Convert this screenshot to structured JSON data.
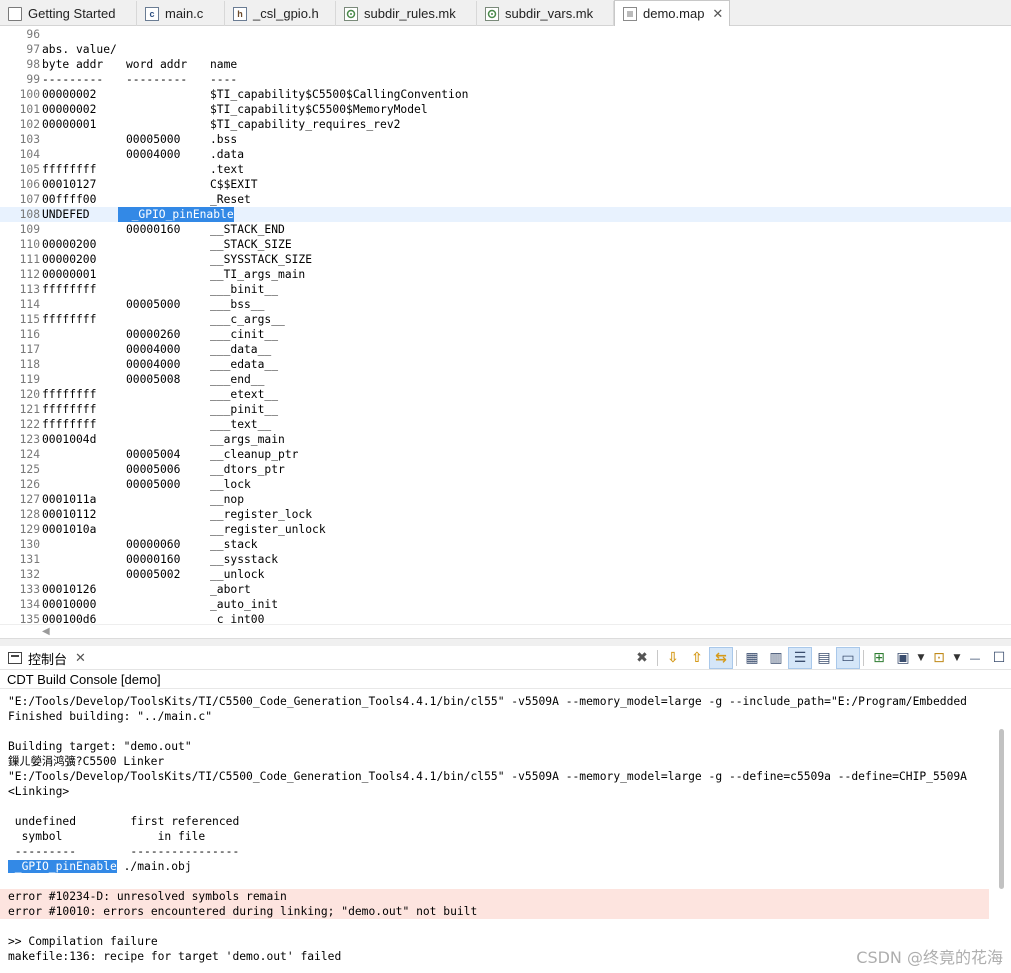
{
  "tabs": [
    {
      "label": "Getting Started",
      "icon": "page-icon"
    },
    {
      "label": "main.c",
      "icon": "c-file-icon"
    },
    {
      "label": "_csl_gpio.h",
      "icon": "h-file-icon"
    },
    {
      "label": "subdir_rules.mk",
      "icon": "makefile-icon"
    },
    {
      "label": "subdir_vars.mk",
      "icon": "makefile-icon"
    },
    {
      "label": "demo.map",
      "icon": "map-file-icon",
      "active": true,
      "close": "✕"
    }
  ],
  "editor": {
    "lines": [
      {
        "n": "96",
        "a": "",
        "b": "",
        "c": ""
      },
      {
        "n": "97",
        "a": "abs. value/",
        "b": "",
        "c": ""
      },
      {
        "n": "98",
        "a": "byte addr",
        "b": "word addr",
        "c": "name"
      },
      {
        "n": "99",
        "a": "---------",
        "b": "---------",
        "c": "----"
      },
      {
        "n": "100",
        "a": "00000002",
        "b": "",
        "c": "$TI_capability$C5500$CallingConvention"
      },
      {
        "n": "101",
        "a": "00000002",
        "b": "",
        "c": "$TI_capability$C5500$MemoryModel"
      },
      {
        "n": "102",
        "a": "00000001",
        "b": "",
        "c": "$TI_capability_requires_rev2"
      },
      {
        "n": "103",
        "a": "",
        "b": "00005000",
        "c": ".bss"
      },
      {
        "n": "104",
        "a": "",
        "b": "00004000",
        "c": ".data"
      },
      {
        "n": "105",
        "a": "ffffffff",
        "b": "",
        "c": ".text"
      },
      {
        "n": "106",
        "a": "00010127",
        "b": "",
        "c": "C$$EXIT"
      },
      {
        "n": "107",
        "a": "00ffff00",
        "b": "",
        "c": "_Reset"
      },
      {
        "n": "108",
        "a": "UNDEFED",
        "b": "",
        "c": "",
        "sel": "  _GPIO_pinEnable"
      },
      {
        "n": "109",
        "a": "",
        "b": "00000160",
        "c": "__STACK_END"
      },
      {
        "n": "110",
        "a": "00000200",
        "b": "",
        "c": "__STACK_SIZE"
      },
      {
        "n": "111",
        "a": "00000200",
        "b": "",
        "c": "__SYSSTACK_SIZE"
      },
      {
        "n": "112",
        "a": "00000001",
        "b": "",
        "c": "__TI_args_main"
      },
      {
        "n": "113",
        "a": "ffffffff",
        "b": "",
        "c": "___binit__"
      },
      {
        "n": "114",
        "a": "",
        "b": "00005000",
        "c": "___bss__"
      },
      {
        "n": "115",
        "a": "ffffffff",
        "b": "",
        "c": "___c_args__"
      },
      {
        "n": "116",
        "a": "",
        "b": "00000260",
        "c": "___cinit__"
      },
      {
        "n": "117",
        "a": "",
        "b": "00004000",
        "c": "___data__"
      },
      {
        "n": "118",
        "a": "",
        "b": "00004000",
        "c": "___edata__"
      },
      {
        "n": "119",
        "a": "",
        "b": "00005008",
        "c": "___end__"
      },
      {
        "n": "120",
        "a": "ffffffff",
        "b": "",
        "c": "___etext__"
      },
      {
        "n": "121",
        "a": "ffffffff",
        "b": "",
        "c": "___pinit__"
      },
      {
        "n": "122",
        "a": "ffffffff",
        "b": "",
        "c": "___text__"
      },
      {
        "n": "123",
        "a": "0001004d",
        "b": "",
        "c": "__args_main"
      },
      {
        "n": "124",
        "a": "",
        "b": "00005004",
        "c": "__cleanup_ptr"
      },
      {
        "n": "125",
        "a": "",
        "b": "00005006",
        "c": "__dtors_ptr"
      },
      {
        "n": "126",
        "a": "",
        "b": "00005000",
        "c": "__lock"
      },
      {
        "n": "127",
        "a": "0001011a",
        "b": "",
        "c": "__nop"
      },
      {
        "n": "128",
        "a": "00010112",
        "b": "",
        "c": "__register_lock"
      },
      {
        "n": "129",
        "a": "0001010a",
        "b": "",
        "c": "__register_unlock"
      },
      {
        "n": "130",
        "a": "",
        "b": "00000060",
        "c": "__stack"
      },
      {
        "n": "131",
        "a": "",
        "b": "00000160",
        "c": "__sysstack"
      },
      {
        "n": "132",
        "a": "",
        "b": "00005002",
        "c": "__unlock"
      },
      {
        "n": "133",
        "a": "00010126",
        "b": "",
        "c": "_abort"
      },
      {
        "n": "134",
        "a": "00010000",
        "b": "",
        "c": "_auto_init"
      },
      {
        "n": "135",
        "a": "000100d6",
        "b": "",
        "c": "_c_int00"
      }
    ]
  },
  "console": {
    "view_title": "控制台",
    "close": "✕",
    "name": "CDT Build Console [demo]",
    "lines": [
      {
        "t": "\"E:/Tools/Develop/ToolsKits/TI/C5500_Code_Generation_Tools4.4.1/bin/cl55\" -v5509A --memory_model=large -g --include_path=\"E:/Program/Embedded"
      },
      {
        "t": "Finished building: \"../main.c\""
      },
      {
        "t": ""
      },
      {
        "t": "Building target: \"demo.out\""
      },
      {
        "t": "鏁ㄦ嫈涓鸿彍?C5500 Linker"
      },
      {
        "t": "\"E:/Tools/Develop/ToolsKits/TI/C5500_Code_Generation_Tools4.4.1/bin/cl55\" -v5509A --memory_model=large -g --define=c5509a --define=CHIP_5509A"
      },
      {
        "t": "<Linking>"
      },
      {
        "t": ""
      },
      {
        "t": " undefined        first referenced"
      },
      {
        "t": "  symbol              in file"
      },
      {
        "t": " ---------        ----------------"
      },
      {
        "t": " ./main.obj",
        "sel": " _GPIO_pinEnable"
      },
      {
        "t": ""
      },
      {
        "t": "error #10234-D: unresolved symbols remain",
        "err": true
      },
      {
        "t": "error #10010: errors encountered during linking; \"demo.out\" not built",
        "err": true
      },
      {
        "t": ""
      },
      {
        "t": ">> Compilation failure"
      },
      {
        "t": "makefile:136: recipe for target 'demo.out' failed"
      }
    ]
  },
  "toolbar": [
    {
      "name": "remove-all-terminated-icon",
      "glyph": "✖"
    },
    {
      "name": "next-error-icon",
      "glyph": "⇩"
    },
    {
      "name": "previous-error-icon",
      "glyph": "⇧"
    },
    {
      "name": "show-error-icon",
      "glyph": "⇆"
    },
    {
      "name": "copy-build-log-icon",
      "glyph": "▦"
    },
    {
      "name": "scroll-lock-icon",
      "glyph": "🔒"
    },
    {
      "name": "word-wrap-icon",
      "glyph": "☰"
    },
    {
      "name": "clear-console-icon",
      "glyph": "▤"
    },
    {
      "name": "pin-console-icon",
      "glyph": "▭"
    },
    {
      "name": "open-console-icon",
      "glyph": "⊞"
    },
    {
      "name": "display-selected-console-icon",
      "glyph": "▣"
    },
    {
      "name": "new-console-icon",
      "glyph": "⊡"
    },
    {
      "name": "minimize-icon",
      "glyph": "—"
    },
    {
      "name": "maximize-icon",
      "glyph": "☐"
    }
  ],
  "watermark": "CSDN @终竟的花海",
  "colors": {
    "selection": "#3389e6",
    "current_line": "#e8f2fe",
    "error_bg": "#fde4df"
  }
}
